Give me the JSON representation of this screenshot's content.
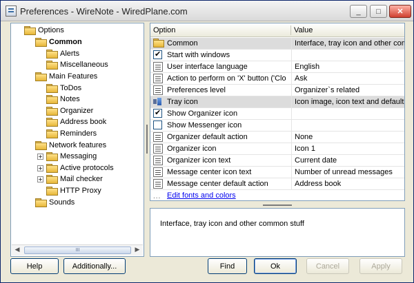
{
  "window": {
    "title": "Preferences - WireNote - WiredPlane.com"
  },
  "title_buttons": {
    "minimize": "_",
    "maximize": "□",
    "close": "✕"
  },
  "tree": {
    "items": [
      {
        "label": "Options",
        "bold": false,
        "expander": ""
      },
      {
        "label": "Common",
        "bold": true,
        "expander": ""
      },
      {
        "label": "Alerts",
        "bold": false,
        "expander": ""
      },
      {
        "label": "Miscellaneous",
        "bold": false,
        "expander": ""
      },
      {
        "label": "Main Features",
        "bold": false,
        "expander": ""
      },
      {
        "label": "ToDos",
        "bold": false,
        "expander": ""
      },
      {
        "label": "Notes",
        "bold": false,
        "expander": ""
      },
      {
        "label": "Organizer",
        "bold": false,
        "expander": ""
      },
      {
        "label": "Address book",
        "bold": false,
        "expander": ""
      },
      {
        "label": "Reminders",
        "bold": false,
        "expander": ""
      },
      {
        "label": "Network features",
        "bold": false,
        "expander": ""
      },
      {
        "label": "Messaging",
        "bold": false,
        "expander": "+"
      },
      {
        "label": "Active protocols",
        "bold": false,
        "expander": "+"
      },
      {
        "label": "Mail checker",
        "bold": false,
        "expander": "+"
      },
      {
        "label": "HTTP Proxy",
        "bold": false,
        "expander": ""
      },
      {
        "label": "Sounds",
        "bold": false,
        "expander": ""
      }
    ],
    "scroll_thumb_grip": "III"
  },
  "grid": {
    "col_option": "Option",
    "col_value": "Value",
    "rows": [
      {
        "option": "Common",
        "value": "Interface, tray icon and other comm",
        "icon": "folder-icon",
        "group": true
      },
      {
        "option": "Start with windows",
        "value": "",
        "icon": "checkbox-checked",
        "group": false
      },
      {
        "option": "User interface language",
        "value": "English",
        "icon": "property-icon",
        "group": false
      },
      {
        "option": "Action to perform on 'X' button ('Clo",
        "value": "Ask",
        "icon": "property-icon",
        "group": false
      },
      {
        "option": "Preferences level",
        "value": "Organizer`s related",
        "icon": "property-icon",
        "group": false
      },
      {
        "option": "Tray icon",
        "value": "Icon image, icon text and default tra",
        "icon": "tray-icon",
        "group": true
      },
      {
        "option": "Show Organizer icon",
        "value": "",
        "icon": "checkbox-checked",
        "group": false
      },
      {
        "option": "Show Messenger icon",
        "value": "",
        "icon": "checkbox-unchecked",
        "group": false
      },
      {
        "option": "Organizer default action",
        "value": "None",
        "icon": "property-icon",
        "group": false
      },
      {
        "option": "Organizer icon",
        "value": "Icon 1",
        "icon": "property-icon",
        "group": false
      },
      {
        "option": "Organizer icon text",
        "value": "Current date",
        "icon": "property-icon",
        "group": false
      },
      {
        "option": "Message center icon text",
        "value": "Number of unread messages",
        "icon": "property-icon",
        "group": false
      },
      {
        "option": "Message center default action",
        "value": "Address book",
        "icon": "property-icon",
        "group": false
      }
    ],
    "link_text": "Edit fonts and colors",
    "link_prefix": "..."
  },
  "description": "Interface, tray icon and other common stuff",
  "buttons": {
    "help": "Help",
    "additionally": "Additionally...",
    "find": "Find",
    "ok": "Ok",
    "cancel": "Cancel",
    "apply": "Apply"
  }
}
